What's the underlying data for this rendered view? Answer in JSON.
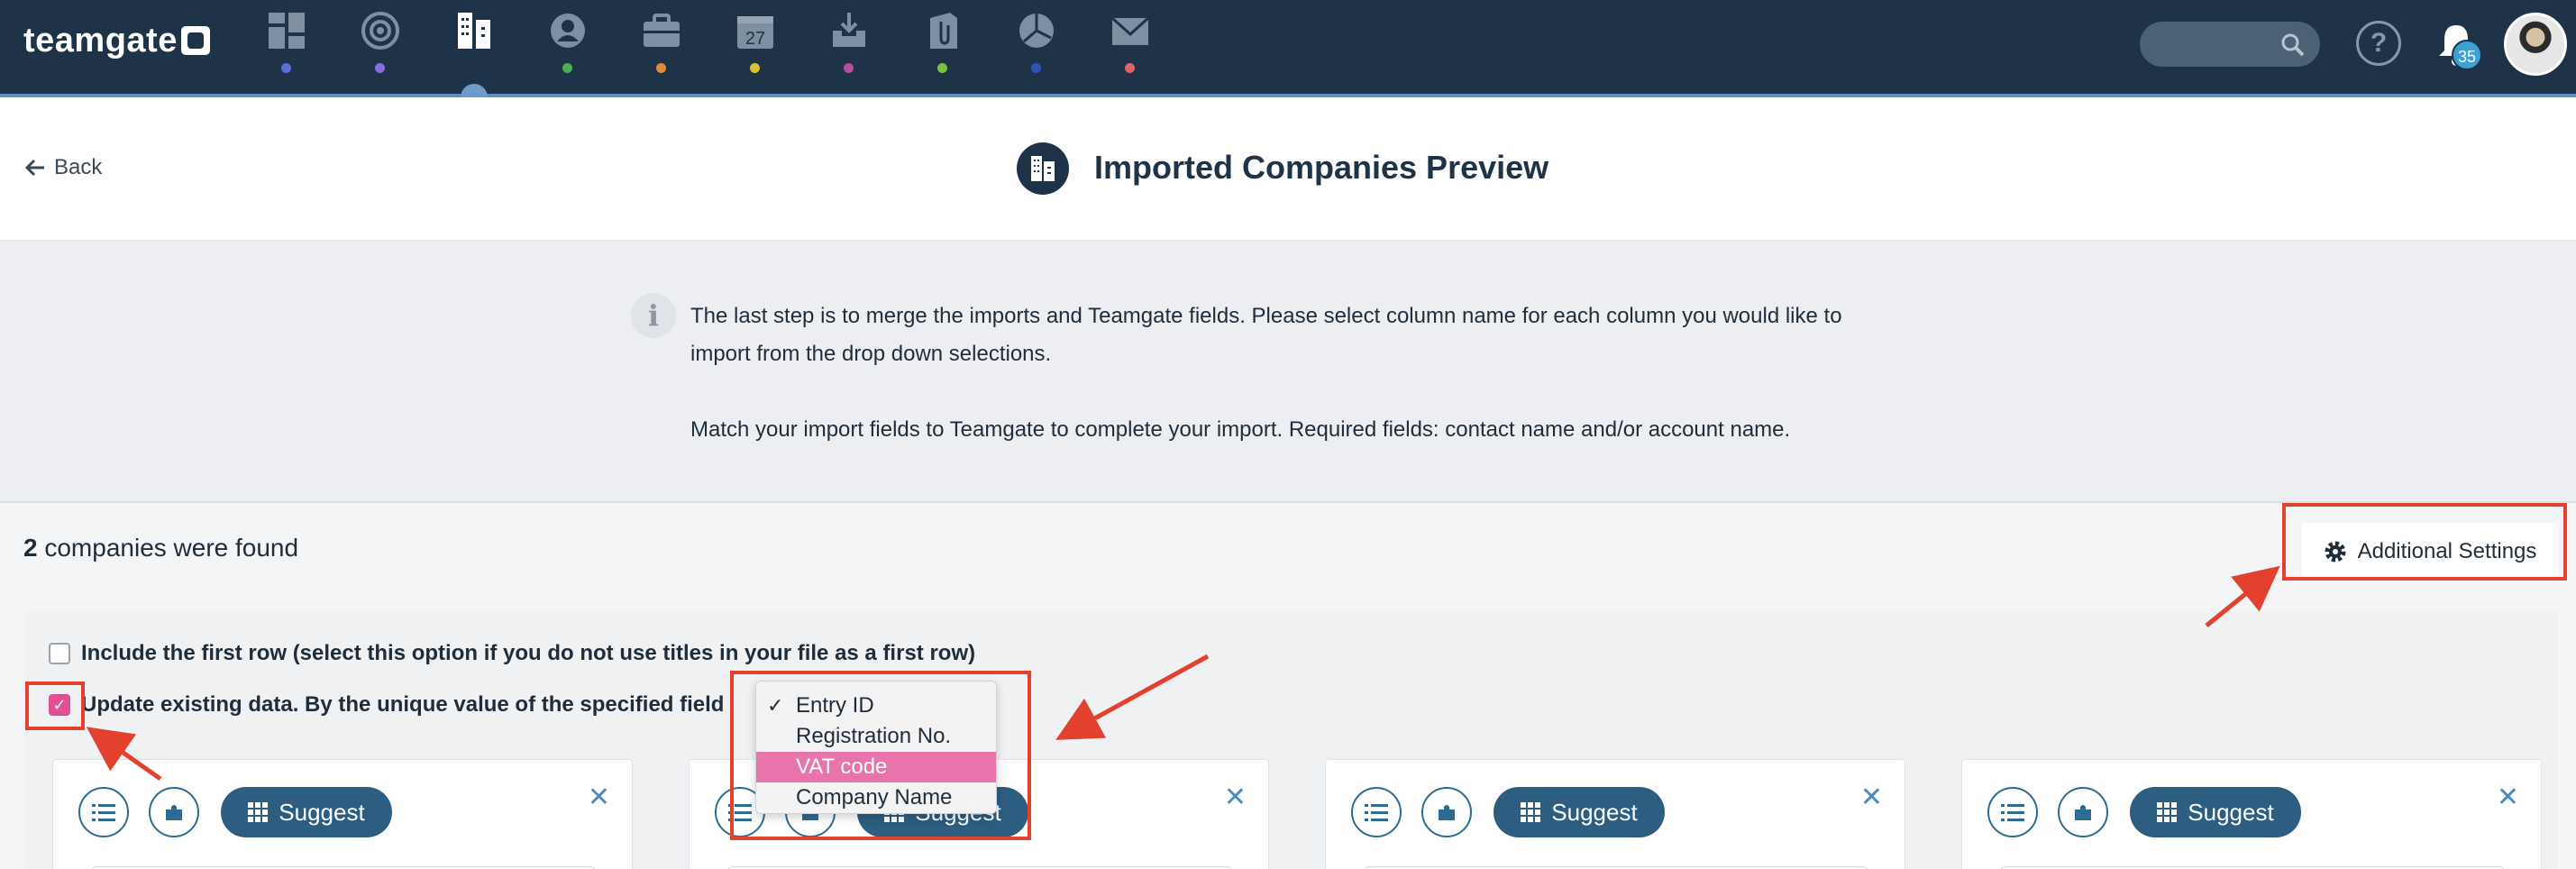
{
  "app": {
    "logo": "teamgate",
    "notifications_count": "35",
    "nav_items": [
      {
        "name": "dashboard-icon",
        "dot": "#5a6fd8"
      },
      {
        "name": "target-icon",
        "dot": "#8a6be0"
      },
      {
        "name": "companies-icon",
        "dot": ""
      },
      {
        "name": "contacts-icon",
        "dot": "#4caf50"
      },
      {
        "name": "deals-icon",
        "dot": "#e08a3c"
      },
      {
        "name": "calendar-icon",
        "dot": "#d8c230"
      },
      {
        "name": "leads-icon",
        "dot": "#b0509e"
      },
      {
        "name": "files-icon",
        "dot": "#7cc242"
      },
      {
        "name": "reports-icon",
        "dot": "#2f52b8"
      },
      {
        "name": "mail-icon",
        "dot": "#e06464"
      }
    ],
    "calendar_day": "27"
  },
  "header": {
    "back_label": "Back",
    "title": "Imported Companies Preview"
  },
  "info": {
    "paragraph1": "The last step is to merge the imports and Teamgate fields. Please select column name for each column you would like to import from the drop down selections.",
    "paragraph2": "Match your import fields to Teamgate to complete your import. Required fields: contact name and/or account name."
  },
  "main": {
    "found_count": "2",
    "found_text": " companies were found",
    "settings_label": "Additional Settings",
    "include_first_row_label": "Include the first row (select this option if you do not use titles in your file as a first row)",
    "update_existing_label": "Update existing data.  By the unique value of the specified field",
    "dropdown_options": [
      {
        "label": "Entry ID",
        "checked": true,
        "highlighted": false
      },
      {
        "label": "Registration No.",
        "checked": false,
        "highlighted": false
      },
      {
        "label": "VAT code",
        "checked": false,
        "highlighted": true
      },
      {
        "label": "Company Name",
        "checked": false,
        "highlighted": false
      }
    ],
    "suggest_label": "Suggest",
    "close_symbol": "✕"
  },
  "colors": {
    "nav_bg": "#1e3347",
    "accent_pink": "#e14f95",
    "annotation_red": "#e4402e",
    "suggest_bg": "#2d5d80"
  }
}
